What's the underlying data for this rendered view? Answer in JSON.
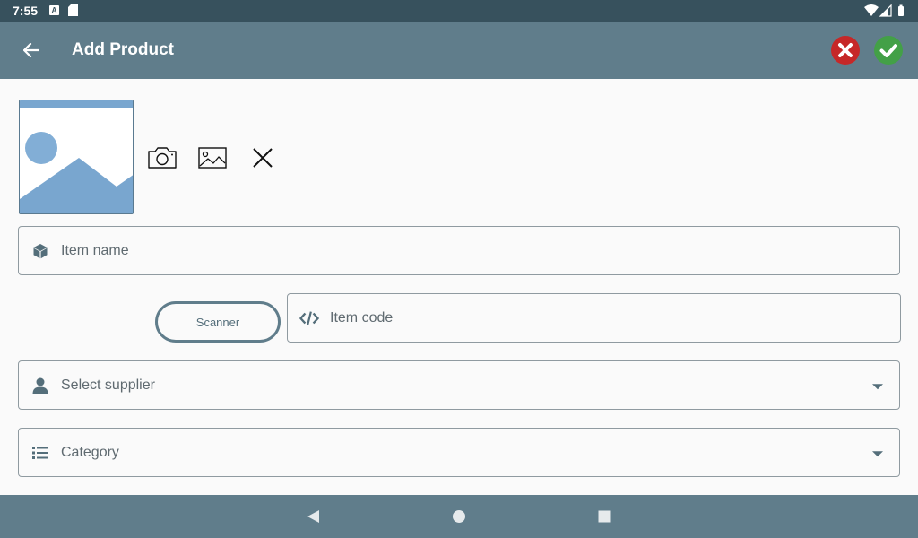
{
  "status_bar": {
    "time": "7:55",
    "notification_icon": "a-icon",
    "sd_icon": "sd-card-icon",
    "wifi_icon": "wifi-icon",
    "signal_icon": "signal-icon",
    "battery_icon": "battery-icon"
  },
  "app_bar": {
    "title": "Add Product",
    "back_icon": "arrow-back-icon",
    "cancel_icon": "cancel-icon",
    "confirm_icon": "check-icon",
    "colors": {
      "background": "#607d8b",
      "cancel": "#c62828",
      "confirm": "#43a047"
    }
  },
  "image_section": {
    "placeholder_icon": "image-placeholder-icon",
    "actions": [
      "camera-icon",
      "gallery-icon",
      "close-icon"
    ]
  },
  "form": {
    "item_name": {
      "placeholder": "Item name",
      "icon": "cube-icon"
    },
    "scanner_button": {
      "label": "Scanner"
    },
    "item_code": {
      "placeholder": "Item code",
      "icon": "code-icon"
    },
    "supplier": {
      "placeholder": "Select supplier",
      "icon": "person-icon"
    },
    "category": {
      "placeholder": "Category",
      "icon": "list-icon"
    }
  },
  "nav_bar": {
    "buttons": [
      "back-triangle-icon",
      "home-circle-icon",
      "recents-square-icon"
    ]
  }
}
